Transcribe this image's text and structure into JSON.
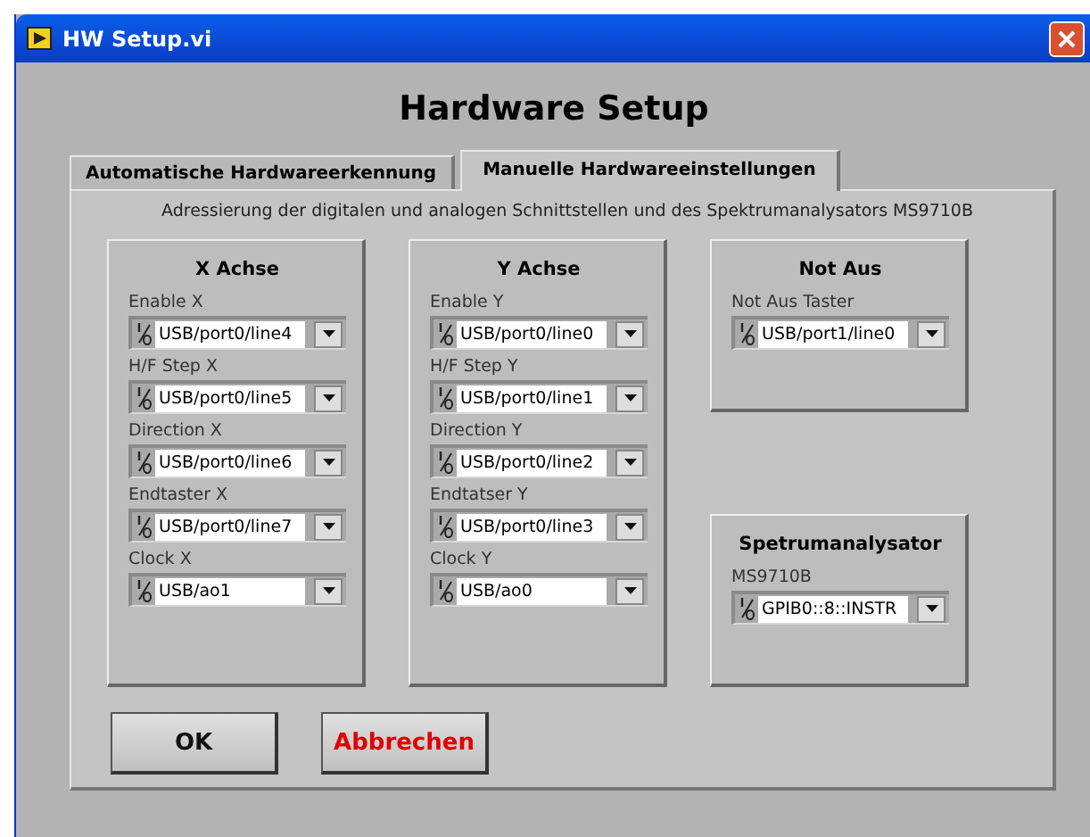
{
  "window": {
    "title": "HW Setup.vi"
  },
  "heading": "Hardware Setup",
  "tabs": [
    {
      "label": "Automatische Hardwareerkennung",
      "selected": false
    },
    {
      "label": "Manuelle Hardwareeinstellungen",
      "selected": true
    }
  ],
  "description": "Adressierung der digitalen und analogen Schnittstellen und des Spektrumanalysators MS9710B",
  "groups": [
    {
      "title": "X Achse",
      "fields": [
        {
          "label": "Enable X",
          "value": "USB/port0/line4"
        },
        {
          "label": "H/F Step X",
          "value": "USB/port0/line5"
        },
        {
          "label": "Direction X",
          "value": "USB/port0/line6"
        },
        {
          "label": "Endtaster X",
          "value": "USB/port0/line7"
        },
        {
          "label": "Clock X",
          "value": "USB/ao1"
        }
      ]
    },
    {
      "title": "Y Achse",
      "fields": [
        {
          "label": "Enable Y",
          "value": "USB/port0/line0"
        },
        {
          "label": "H/F Step Y",
          "value": "USB/port0/line1"
        },
        {
          "label": "Direction Y",
          "value": "USB/port0/line2"
        },
        {
          "label": "Endtatser Y",
          "value": "USB/port0/line3"
        },
        {
          "label": "Clock Y",
          "value": "USB/ao0"
        }
      ]
    },
    {
      "title": "Not Aus",
      "fields": [
        {
          "label": "Not Aus Taster",
          "value": "USB/port1/line0"
        }
      ]
    },
    {
      "title": "Spetrumanalysator",
      "fields": [
        {
          "label": "MS9710B",
          "value": "GPIB0::8::INSTR"
        }
      ]
    }
  ],
  "buttons": [
    {
      "label": "OK",
      "kind": "default"
    },
    {
      "label": "Abbrechen",
      "kind": "cancel"
    }
  ]
}
